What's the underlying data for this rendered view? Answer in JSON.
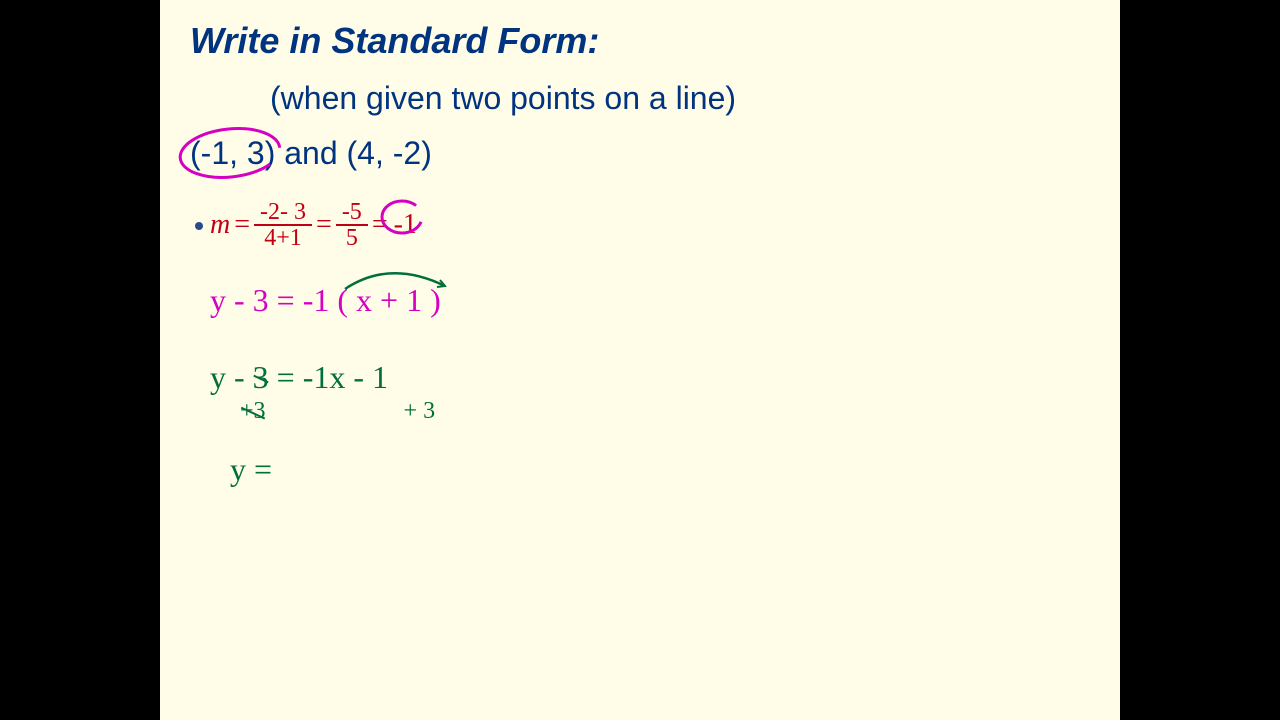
{
  "title": "Write in Standard Form:",
  "subtitle": "(when given two points on a line)",
  "points": {
    "point1": "(-1, 3)",
    "connector": "  and  ",
    "point2": "(4, -2)"
  },
  "slope": {
    "m_label": "m",
    "equals1": "=",
    "frac1_top": "-2- 3",
    "frac1_bot": "4+1",
    "equals2": "=",
    "frac2_top": "-5",
    "frac2_bot": "5",
    "equals3": "=",
    "result": "-1"
  },
  "point_slope": {
    "equation": "y - 3 = -1 ( x + 1 )"
  },
  "green_step1": {
    "y_minus": "y - ",
    "three": "3",
    "rest": " = -1x - 1"
  },
  "green_sub": {
    "left": "+3",
    "gap": "                       ",
    "right": "+ 3"
  },
  "green_step2": {
    "text": "y ="
  },
  "colors": {
    "navy": "#003380",
    "red": "#c00015",
    "magenta": "#d600c3",
    "green": "#006f3c",
    "bg": "#fffde7"
  }
}
